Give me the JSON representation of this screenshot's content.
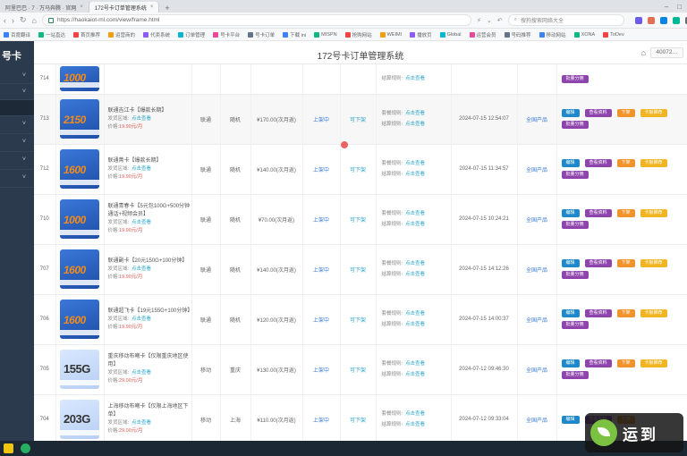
{
  "browser": {
    "tabs": [
      {
        "label": "阿里巴巴 · 7 · 万马奔腾 · 官网",
        "active": false
      },
      {
        "label": "172号卡订单管理系统",
        "active": true
      }
    ],
    "new_tab": "+",
    "url": "https://haokaiot-ml.com/view/frame.html",
    "search_placeholder": "搜狗搜索网络大全",
    "bookmarks": [
      "百度翻译",
      "一站直达",
      "首页推荐",
      "运营商的",
      "代卖系统",
      "订单管理",
      "号卡平台",
      "号卡订单",
      "下载 ini",
      "MISPN",
      "抢购网站",
      "WEIMI",
      "播放页",
      "Global",
      "运营会员",
      "号码推荐",
      "移动网站",
      "XONA",
      "ToDev"
    ]
  },
  "sidebar": {
    "brand": "号卡",
    "items": [
      {
        "label": "˅",
        "active": false
      },
      {
        "label": "˅",
        "active": false
      },
      {
        "label": "",
        "active": true
      },
      {
        "label": "˅",
        "active": false
      },
      {
        "label": "˅",
        "active": false
      },
      {
        "label": "˅",
        "active": false
      },
      {
        "label": "˅",
        "active": false
      }
    ]
  },
  "header": {
    "title": "172号卡订单管理系统",
    "user_id": "40072…"
  },
  "table": {
    "rows": [
      {
        "id": "714",
        "partial": true,
        "thumb_value": "1000",
        "title": "",
        "area": "",
        "area_link": "",
        "price_label": "",
        "price": "",
        "carrier": "",
        "number": "",
        "monthly": "",
        "up": "",
        "down": "",
        "pair1_label": "",
        "pair1_link": "",
        "pair2_label": "结算规则:",
        "pair2_link": "点击查看",
        "date": "",
        "status": "",
        "ops": [
          {
            "label": "批量分佣",
            "color": "purple"
          }
        ]
      },
      {
        "id": "713",
        "partial": false,
        "highlight": true,
        "thumb_value": "2150",
        "title": "联通吉江卡【爆款长期】",
        "area": "发货区域:",
        "area_link": "点击查看",
        "price_label": "价格:",
        "price": "19.90元/月",
        "carrier": "联通",
        "number": "随机",
        "monthly": "¥170.00(次月返)",
        "up": "上架中",
        "down": "可下架",
        "pair1_label": "套餐规则:",
        "pair1_link": "点击查看",
        "pair2_label": "结算规则:",
        "pair2_link": "点击查看",
        "date": "2024-07-15 12:54:07",
        "status": "全国产品",
        "ops": [
          {
            "label": "编辑",
            "color": "blue"
          },
          {
            "label": "查看资料",
            "color": "purple"
          },
          {
            "label": "下架",
            "color": "orange"
          },
          {
            "label": "卡板推荐",
            "color": "yellow"
          },
          {
            "label": "批量分佣",
            "color": "purple"
          }
        ]
      },
      {
        "id": "712",
        "partial": false,
        "thumb_value": "1600",
        "title": "联通菁卡【爆款长期】",
        "area": "发货区域:",
        "area_link": "点击查看",
        "price_label": "价格:",
        "price": "19.90元/月",
        "carrier": "联通",
        "number": "随机",
        "monthly": "¥140.00(次月返)",
        "up": "上架中",
        "down": "可下架",
        "pair1_label": "套餐规则:",
        "pair1_link": "点击查看",
        "pair2_label": "结算规则:",
        "pair2_link": "点击查看",
        "date": "2024-07-15 11:34:57",
        "status": "全国产品",
        "ops": [
          {
            "label": "编辑",
            "color": "blue"
          },
          {
            "label": "查看资料",
            "color": "purple"
          },
          {
            "label": "下架",
            "color": "orange"
          },
          {
            "label": "卡板推荐",
            "color": "yellow"
          },
          {
            "label": "批量分佣",
            "color": "purple"
          }
        ]
      },
      {
        "id": "710",
        "partial": false,
        "thumb_value": "1000",
        "title": "联通青春卡【5元包100G+500分钟通话+视频会员】",
        "area": "发货区域:",
        "area_link": "点击查看",
        "price_label": "价格:",
        "price": "19.90元/月",
        "carrier": "联通",
        "number": "随机",
        "monthly": "¥70.00(次月返)",
        "up": "上架中",
        "down": "可下架",
        "pair1_label": "套餐规则:",
        "pair1_link": "点击查看",
        "pair2_label": "结算规则:",
        "pair2_link": "点击查看",
        "date": "2024-07-15 10:24:21",
        "status": "全国产品",
        "ops": [
          {
            "label": "编辑",
            "color": "blue"
          },
          {
            "label": "查看资料",
            "color": "purple"
          },
          {
            "label": "下架",
            "color": "orange"
          },
          {
            "label": "卡板推荐",
            "color": "yellow"
          },
          {
            "label": "批量分佣",
            "color": "purple"
          }
        ]
      },
      {
        "id": "707",
        "partial": false,
        "thumb_value": "1600",
        "title": "联通副卡【20元150G+100分钟】",
        "area": "发货区域:",
        "area_link": "点击查看",
        "price_label": "价格:",
        "price": "19.90元/月",
        "carrier": "联通",
        "number": "随机",
        "monthly": "¥140.00(次月返)",
        "up": "上架中",
        "down": "可下架",
        "pair1_label": "套餐规则:",
        "pair1_link": "点击查看",
        "pair2_label": "结算规则:",
        "pair2_link": "点击查看",
        "date": "2024-07-15 14:12:26",
        "status": "全国产品",
        "ops": [
          {
            "label": "编辑",
            "color": "blue"
          },
          {
            "label": "查看资料",
            "color": "purple"
          },
          {
            "label": "下架",
            "color": "orange"
          },
          {
            "label": "卡板推荐",
            "color": "yellow"
          },
          {
            "label": "批量分佣",
            "color": "purple"
          }
        ]
      },
      {
        "id": "706",
        "partial": false,
        "thumb_value": "1600",
        "title": "联通超飞卡【19元155G+100分钟】",
        "area": "发货区域:",
        "area_link": "点击查看",
        "price_label": "价格:",
        "price": "19.90元/月",
        "carrier": "联通",
        "number": "随机",
        "monthly": "¥120.00(次月返)",
        "up": "上架中",
        "down": "可下架",
        "pair1_label": "套餐规则:",
        "pair1_link": "点击查看",
        "pair2_label": "结算规则:",
        "pair2_link": "点击查看",
        "date": "2024-07-15 14:00:37",
        "status": "全国产品",
        "ops": [
          {
            "label": "编辑",
            "color": "blue"
          },
          {
            "label": "查看资料",
            "color": "purple"
          },
          {
            "label": "下架",
            "color": "orange"
          },
          {
            "label": "卡板推荐",
            "color": "yellow"
          },
          {
            "label": "批量分佣",
            "color": "purple"
          }
        ]
      },
      {
        "id": "705",
        "partial": false,
        "thumb_value": "155G",
        "green": true,
        "title": "重庆移动布曦卡【仅限重庆地区使用】",
        "area": "发货区域:",
        "area_link": "点击查看",
        "price_label": "价格:",
        "price": "29.00元/月",
        "carrier": "移动",
        "number": "重庆",
        "monthly": "¥130.00(次月返)",
        "up": "上架中",
        "down": "可下架",
        "pair1_label": "套餐规则:",
        "pair1_link": "点击查看",
        "pair2_label": "结算规则:",
        "pair2_link": "点击查看",
        "date": "2024-07-12 09:46:30",
        "status": "全国产品",
        "ops": [
          {
            "label": "编辑",
            "color": "blue"
          },
          {
            "label": "查看资料",
            "color": "purple"
          },
          {
            "label": "下架",
            "color": "orange"
          },
          {
            "label": "卡板推荐",
            "color": "yellow"
          },
          {
            "label": "批量分佣",
            "color": "purple"
          }
        ]
      },
      {
        "id": "704",
        "partial": false,
        "thumb_value": "203G",
        "green": true,
        "title": "上海移动布曦卡【仅限上海地区下单】",
        "area": "发货区域:",
        "area_link": "点击查看",
        "price_label": "价格:",
        "price": "29.00元/月",
        "carrier": "移动",
        "number": "上海",
        "monthly": "¥110.00(次月返)",
        "up": "上架中",
        "down": "可下架",
        "pair1_label": "套餐规则:",
        "pair1_link": "点击查看",
        "pair2_label": "结算规则:",
        "pair2_link": "点击查看",
        "date": "2024-07-12 09:33:04",
        "status": "全国产品",
        "ops": [
          {
            "label": "编辑",
            "color": "blue"
          },
          {
            "label": "查看资料",
            "color": "purple"
          },
          {
            "label": "下架",
            "color": "orange"
          }
        ]
      }
    ]
  },
  "watermark": "运到"
}
